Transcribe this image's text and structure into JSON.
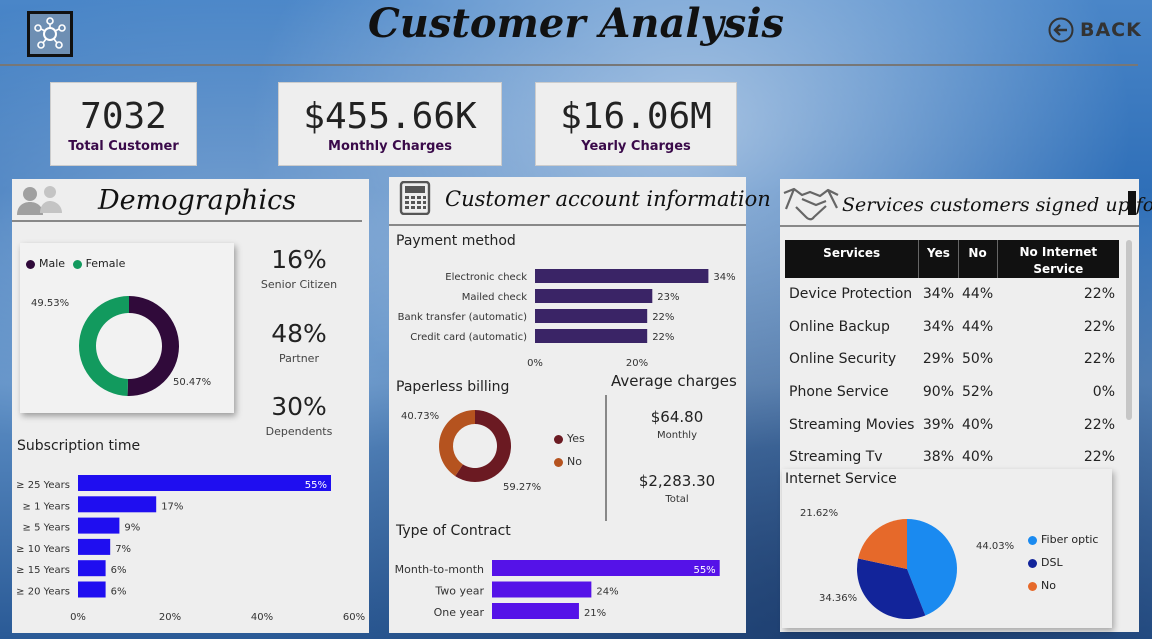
{
  "header": {
    "title": "Customer Analysis",
    "back_label": "BACK"
  },
  "kpis": [
    {
      "value": "7032",
      "label": "Total Customer"
    },
    {
      "value": "$455.66K",
      "label": "Monthly Charges"
    },
    {
      "value": "$16.06M",
      "label": "Yearly Charges"
    }
  ],
  "demographics": {
    "title": "Demographics",
    "legend": [
      {
        "name": "Male",
        "color": "#300a3a"
      },
      {
        "name": "Female",
        "color": "#129a5e"
      }
    ],
    "donut": {
      "female_pct": 49.53,
      "male_pct": 50.47,
      "female_label": "49.53%",
      "male_label": "50.47%"
    },
    "stats": [
      {
        "value": "16%",
        "label": "Senior Citizen"
      },
      {
        "value": "48%",
        "label": "Partner"
      },
      {
        "value": "30%",
        "label": "Dependents"
      }
    ],
    "subscription": {
      "title": "Subscription time",
      "bars": [
        {
          "label": "≥ 25 Years",
          "value": 55,
          "text": "55%"
        },
        {
          "label": "≥ 1 Years",
          "value": 17,
          "text": "17%"
        },
        {
          "label": "≥ 5 Years",
          "value": 9,
          "text": "9%"
        },
        {
          "label": "≥ 10 Years",
          "value": 7,
          "text": "7%"
        },
        {
          "label": "≥ 15 Years",
          "value": 6,
          "text": "6%"
        },
        {
          "label": "≥ 20 Years",
          "value": 6,
          "text": "6%"
        }
      ],
      "ticks": [
        "0%",
        "20%",
        "40%",
        "60%"
      ],
      "color": "#1f0ef0"
    }
  },
  "account": {
    "title": "Customer account information",
    "payment": {
      "title": "Payment method",
      "bars": [
        {
          "label": "Electronic check",
          "value": 34,
          "text": "34%"
        },
        {
          "label": "Mailed check",
          "value": 23,
          "text": "23%"
        },
        {
          "label": "Bank transfer (automatic)",
          "value": 22,
          "text": "22%"
        },
        {
          "label": "Credit card (automatic)",
          "value": 22,
          "text": "22%"
        }
      ],
      "ticks": [
        "0%",
        "20%"
      ],
      "color": "#3a2466"
    },
    "paperless": {
      "title": "Paperless billing",
      "no_label": "40.73%",
      "yes_label": "59.27%",
      "yes_pct": 59.27,
      "no_pct": 40.73,
      "legend": [
        {
          "name": "Yes",
          "color": "#6b1a22"
        },
        {
          "name": "No",
          "color": "#b5531f"
        }
      ]
    },
    "average": {
      "title": "Average charges",
      "monthly_value": "$64.80",
      "monthly_label": "Monthly",
      "total_value": "$2,283.30",
      "total_label": "Total"
    },
    "contract": {
      "title": "Type of Contract",
      "bars": [
        {
          "label": "Month-to-month",
          "value": 55,
          "text": "55%"
        },
        {
          "label": "Two year",
          "value": 24,
          "text": "24%"
        },
        {
          "label": "One year",
          "value": 21,
          "text": "21%"
        }
      ],
      "color": "#5512e8"
    }
  },
  "services": {
    "title": "Services customers signed up for",
    "columns": [
      "Services",
      "Yes",
      "No",
      "No Internet Service"
    ],
    "rows": [
      [
        "Device Protection",
        "34%",
        "44%",
        "22%"
      ],
      [
        "Online Backup",
        "34%",
        "44%",
        "22%"
      ],
      [
        "Online Security",
        "29%",
        "50%",
        "22%"
      ],
      [
        "Phone Service",
        "90%",
        "52%",
        "0%"
      ],
      [
        "Streaming Movies",
        "39%",
        "40%",
        "22%"
      ],
      [
        "Streaming Tv",
        "38%",
        "40%",
        "22%"
      ]
    ]
  },
  "internet": {
    "title": "Internet Service",
    "slices": [
      {
        "name": "Fiber optic",
        "value": 44.03,
        "label": "44.03%",
        "color": "#1a8af0"
      },
      {
        "name": "DSL",
        "value": 34.36,
        "label": "34.36%",
        "color": "#12249a"
      },
      {
        "name": "No",
        "value": 21.62,
        "label": "21.62%",
        "color": "#e6692a"
      }
    ]
  }
}
